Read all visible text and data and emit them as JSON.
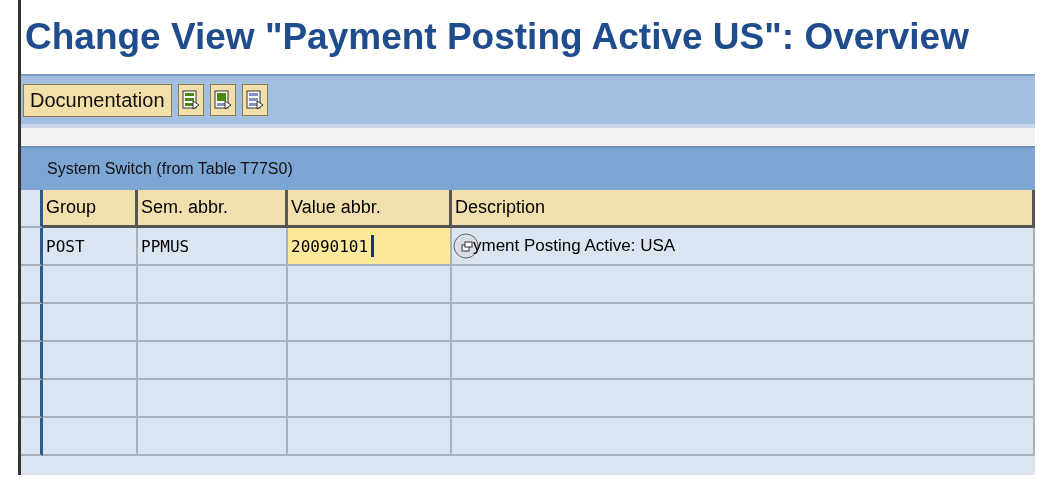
{
  "title": "Change View \"Payment Posting Active US\": Overview",
  "toolbar": {
    "buttons": [
      {
        "kind": "text",
        "label": "Documentation"
      },
      {
        "kind": "icon-green"
      },
      {
        "kind": "icon-green-block"
      },
      {
        "kind": "icon-blue"
      }
    ]
  },
  "section": {
    "title": "System Switch (from Table T77S0)"
  },
  "table": {
    "columns": [
      "Group",
      "Sem. abbr.",
      "Value abbr.",
      "Description"
    ],
    "rows": [
      {
        "cells": [
          {
            "text": "POST",
            "editing": false
          },
          {
            "text": "PPMUS",
            "editing": false
          },
          {
            "text": "20090101",
            "editing": true
          },
          {
            "text": "yment Posting Active: USA",
            "editing": false
          }
        ]
      }
    ]
  }
}
